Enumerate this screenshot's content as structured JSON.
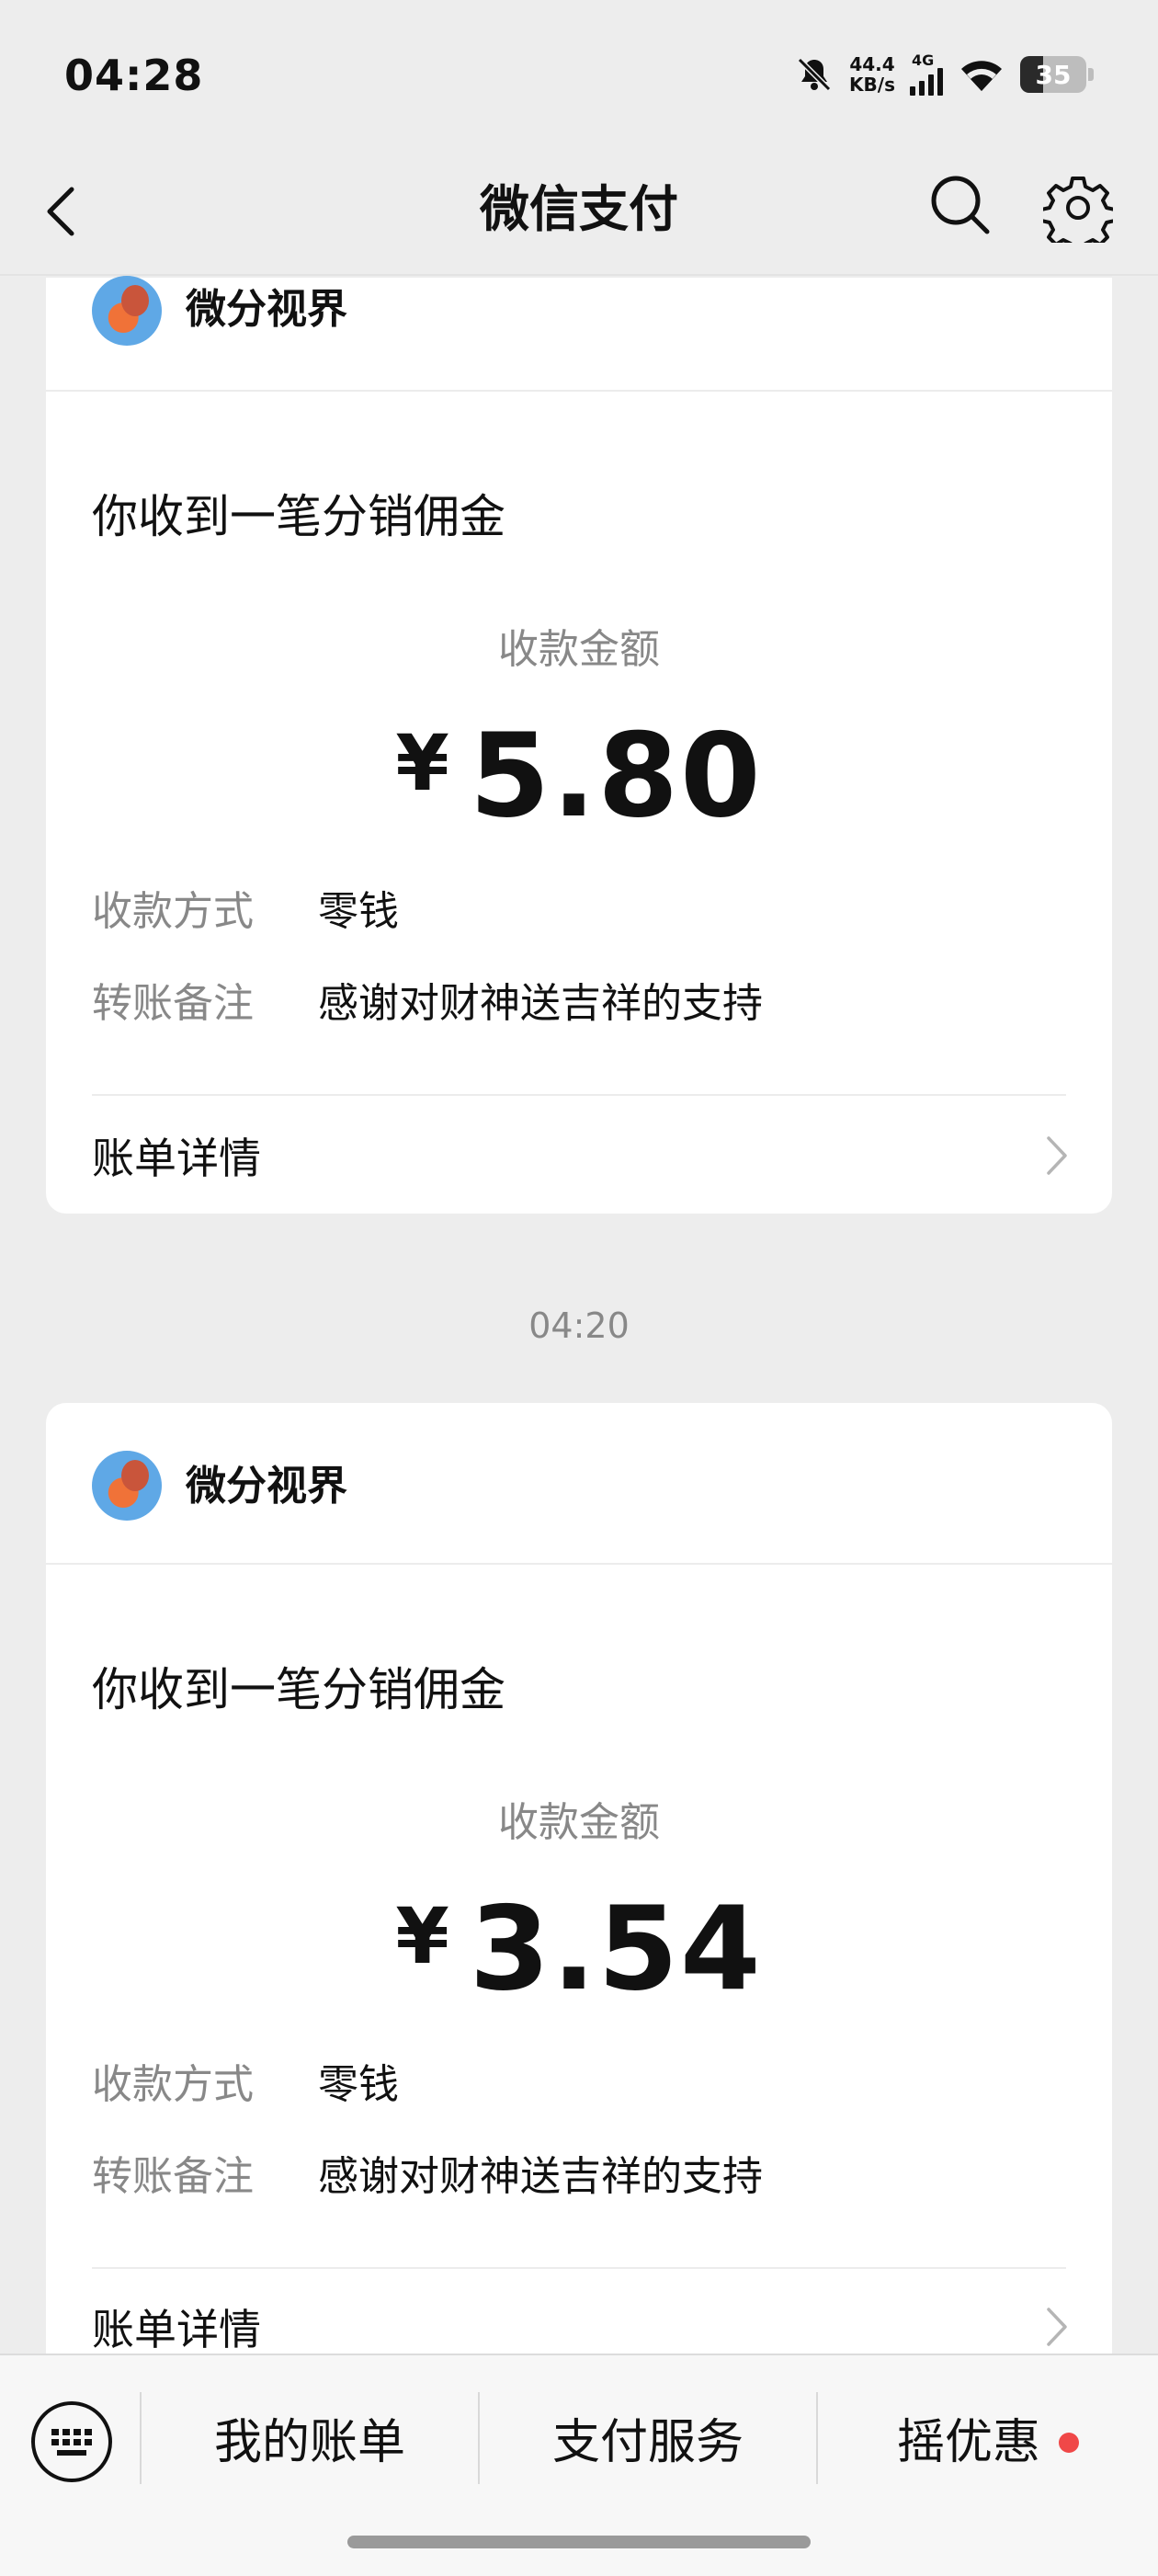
{
  "status_bar": {
    "time": "04:28",
    "net_speed_value": "44.4",
    "net_speed_unit": "KB/s",
    "network_type": "4G",
    "battery_level": "35",
    "battery_fraction": 0.35
  },
  "nav": {
    "title": "微信支付"
  },
  "transactions": [
    {
      "merchant": "微分视界",
      "title": "你收到一笔分销佣金",
      "amount_label": "收款金额",
      "currency": "¥",
      "amount": "5.80",
      "method_label": "收款方式",
      "method_value": "零钱",
      "note_label": "转账备注",
      "note_value": "感谢对财神送吉祥的支持",
      "detail_label": "账单详情"
    },
    {
      "time": "04:20",
      "merchant": "微分视界",
      "title": "你收到一笔分销佣金",
      "amount_label": "收款金额",
      "currency": "¥",
      "amount": "3.54",
      "method_label": "收款方式",
      "method_value": "零钱",
      "note_label": "转账备注",
      "note_value": "感谢对财神送吉祥的支持",
      "detail_label": "账单详情"
    }
  ],
  "bottom_menu": {
    "items": [
      {
        "label": "我的账单"
      },
      {
        "label": "支付服务"
      },
      {
        "label": "摇优惠",
        "has_badge": true
      }
    ]
  }
}
